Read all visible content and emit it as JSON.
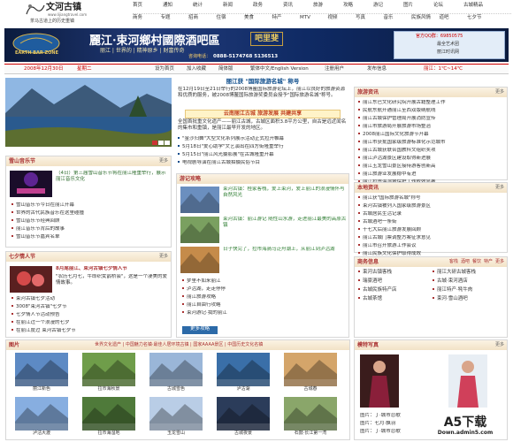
{
  "logo": {
    "main": "文河古镇",
    "url": "www.lijiangtravel.com",
    "slogan": "茶马古道上的历史重镇"
  },
  "nav_row1": [
    "首页",
    "通知",
    "统计",
    "新闻",
    "政务",
    "资讯",
    "旅游",
    "攻略",
    "游记",
    "图片",
    "论坛",
    "古城精品"
  ],
  "nav_row2": [
    "商务",
    "专题",
    "招商",
    "住宿",
    "美食",
    "特产",
    "MTV",
    "视频",
    "写真",
    "音乐",
    "民族风情",
    "道吧",
    "七夕节"
  ],
  "banner": {
    "title": "麗江·束河鄉村國際酒吧區",
    "title_en": "EARTH BAR ZONE",
    "subtitle": "丽江 | 世界的 | 精神原乡 | 财富传奇",
    "badge": "吧里斐",
    "phone_label": "咨询电话：",
    "phone": "0888-5174768    5136513",
    "qq": "官方QQ群：69850575",
    "right1": "最全艺术团",
    "right2": "丽江时讯网"
  },
  "dateline": {
    "date": "2008年12月30日",
    "weekday": "星期二",
    "items": [
      "设为首页",
      "加入收藏",
      "简体版",
      "繁体中文/English Version",
      "注册用户",
      "发布信息"
    ],
    "weather": "丽江：1℃~14℃"
  },
  "headline": {
    "title": "丽江获 \"国际旅游名城\" 称号",
    "text": "在12月19日至21日举行的2008博鳌国际旅游论坛上，丽江以良好的旅游资源和优质的服务，被2008博鳌国际旅游奖委员会授予\"国际旅游名城\"称号。"
  },
  "feature": {
    "title": "云南丽江古城  旅游发展  共建共享",
    "text": "全国首批重文化遗产——丽江古城，古城区面积3.8平方公里，自古是远近闻名的集市和重镇，是丽江最早开发的地区。"
  },
  "news_list": [
    "\"金沙归舞\"大型文化系列展示活动正式拉开帷幕",
    "5月18日\"爱心助学\"文艺演出在四方街隆重举行",
    "5月15日\"丽江风光摄影展\"在古城隆重开幕",
    "电视剧导演在丽江古城拍摄民俗节目"
  ],
  "music_section": {
    "title": "雪山音乐节",
    "more": "更多",
    "lead": "（4日）第三届雪山音乐节将在丽江隆重举行，展示丽江音乐文化",
    "list": [
      "雪山音乐节今日在丽江开幕",
      "世界的古代民族音乐在这里碰撞",
      "雪山音乐节经典回顾",
      "丽江音乐节背后的故事",
      "雪山音乐节嘉宾名单"
    ]
  },
  "qixi_section": {
    "title": "七夕情人节",
    "more": "更多",
    "lead": "8月尾丽江、束河古镇七夕情人节",
    "quote": "\"农历七月七，牛郎织女鹊桥会\"，这是一个凄美的爱情故事。",
    "list": [
      "束河古镇七夕活动",
      "3008\"束河古镇\"七夕节",
      "七夕情人节活动预告",
      "在丽江过一个浪漫的七夕",
      "在丽江度过 束河古镇七夕节"
    ]
  },
  "gonglue": {
    "title": "游记攻略",
    "items": [
      {
        "text": "束河古镇：桂家客栈，爱上束河，爱上丽江的浪漫情怀与自然风光"
      },
      {
        "text": "束河古镇：丽江游记 随性山水游，走进丽江最美的高原古镇"
      },
      {
        "text": "日子快完了，拉市海骑马泛舟湖上，从丽江到泸沽湖"
      }
    ],
    "list": [
      "梦里不如来丽江",
      "泸沽湖，走走停停",
      "丽江旅游攻略",
      "丽江自由行攻略",
      "束河游记·我的丽江"
    ],
    "btn": "更多攻略"
  },
  "travel_news": {
    "title": "旅游资讯",
    "more": "更多",
    "list": [
      "丽江东巴文化研究院开展古籍整理工作",
      "民航东航开通丽江至西双版纳航线",
      "丽江古城保护管理局开展消防宣传",
      "丽江市旅游局开展旅游市场整治",
      "2008丽江国际文化旅游节开幕",
      "丽江市获批国家级旅游标准化示范城市",
      "丽江古城获联合国教科文组织奖项",
      "丽江泸沽湖景区建设取得新进展",
      "丽江玉龙雪山景区接待游客创新高",
      "丽江旅游业发展稳中有进",
      "丽江拉市海湿地保护工作成效显著",
      "丽江推出冬季旅游优惠政策"
    ]
  },
  "local_news": {
    "title": "本地资讯",
    "more": "更多",
    "list": [
      "丽江获\"国际旅游名城\"称号",
      "束河古镇被列入国家级旅游景区",
      "古城居民生活记录",
      "古城酒吧一条街",
      "十七大后丽江旅游发展回顾",
      "丽江古城门票调整方案征求意见",
      "丽江市召开旅游工作会议",
      "丽江民族文化保护取得成效"
    ]
  },
  "merchants": {
    "title": "商务信息",
    "tabs": [
      "客栈",
      "酒吧",
      "餐饮",
      "特产",
      "更多"
    ],
    "list": [
      "束河古镇客栈",
      "丽江大研古城客栈",
      "瑞豪酒吧",
      "古城·束河酒店",
      "古城民族特产店",
      "丽江特产·牦牛肉",
      "古城茶馆",
      "束河·雪山酒吧"
    ]
  },
  "gallery": {
    "title": "图片",
    "links": "世界文化遗产 | 中国魅力名镇·最佳人居环境古镇 | 国家AAAA景区 | 中国历史文化名镇",
    "items": [
      "丽江新色",
      "拉市海秋景",
      "古城雪色",
      "泸沽湖",
      "古城春",
      "泸沽大渡",
      "拉市海湿地",
      "玉龙雪山",
      "古城夜景",
      "石鼓·长江第一湾"
    ]
  },
  "models": {
    "title": "模特写真",
    "more": "更多",
    "captions": [
      "图片：丁·城市恋歌",
      "图片：七月·飘羽",
      "图片：丁·城市恋歌"
    ]
  },
  "watermark": {
    "main": "A5下载",
    "sub": "Down.admin5.com"
  },
  "colors": {
    "accent": "#bb3333",
    "title_bar": "#f2e2c6",
    "blue_band": "#1a3a7c",
    "green": "#2e7d32"
  }
}
